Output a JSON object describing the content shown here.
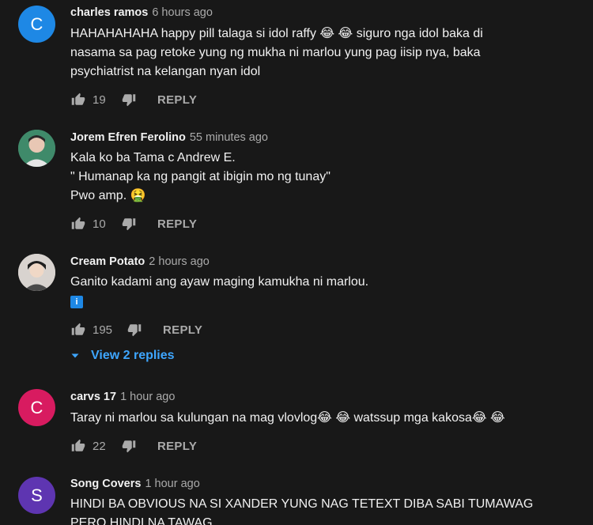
{
  "comments": [
    {
      "author": "charles ramos",
      "time": "6 hours ago",
      "avatar_letter": "C",
      "avatar_color": "#1e88e5",
      "lines": [
        "HAHAHAHAHA happy pill talaga si idol raffy 😂 😂 siguro nga idol baka di",
        "nasama sa pag retoke yung ng mukha ni marlou yung pag iisip nya, baka",
        "psychiatrist na kelangan nyan idol"
      ],
      "likes": "19",
      "reply_label": "REPLY"
    },
    {
      "author": "Jorem Efren Ferolino",
      "time": "55 minutes ago",
      "avatar_letter": "",
      "avatar_color": "#5d8f7c",
      "lines": [
        "Kala ko ba Tama c Andrew E.",
        "\" Humanap ka ng pangit at ibigin mo ng tunay\"",
        "Pwo amp. 🤮"
      ],
      "likes": "10",
      "reply_label": "REPLY"
    },
    {
      "author": "Cream Potato",
      "time": "2 hours ago",
      "avatar_letter": "",
      "avatar_color": "#c9c4c0",
      "lines": [
        "Ganito kadami ang ayaw maging kamukha ni marlou.",
        "ℹ️"
      ],
      "likes": "195",
      "reply_label": "REPLY",
      "view_replies": "View 2 replies"
    },
    {
      "author": "carvs 17",
      "time": "1 hour ago",
      "avatar_letter": "C",
      "avatar_color": "#d81b60",
      "lines": [
        "Taray ni marlou sa kulungan na mag vlovlog😂 😂 watssup mga kakosa😂 😂"
      ],
      "likes": "22",
      "reply_label": "REPLY"
    },
    {
      "author": "Song Covers",
      "time": "1 hour ago",
      "avatar_letter": "S",
      "avatar_color": "#5e35b1",
      "lines": [
        "HINDI BA OBVIOUS NA SI XANDER YUNG NAG TETEXT DIBA SABI TUMAWAG",
        "PERO HINDI NA TAWAG"
      ]
    }
  ]
}
